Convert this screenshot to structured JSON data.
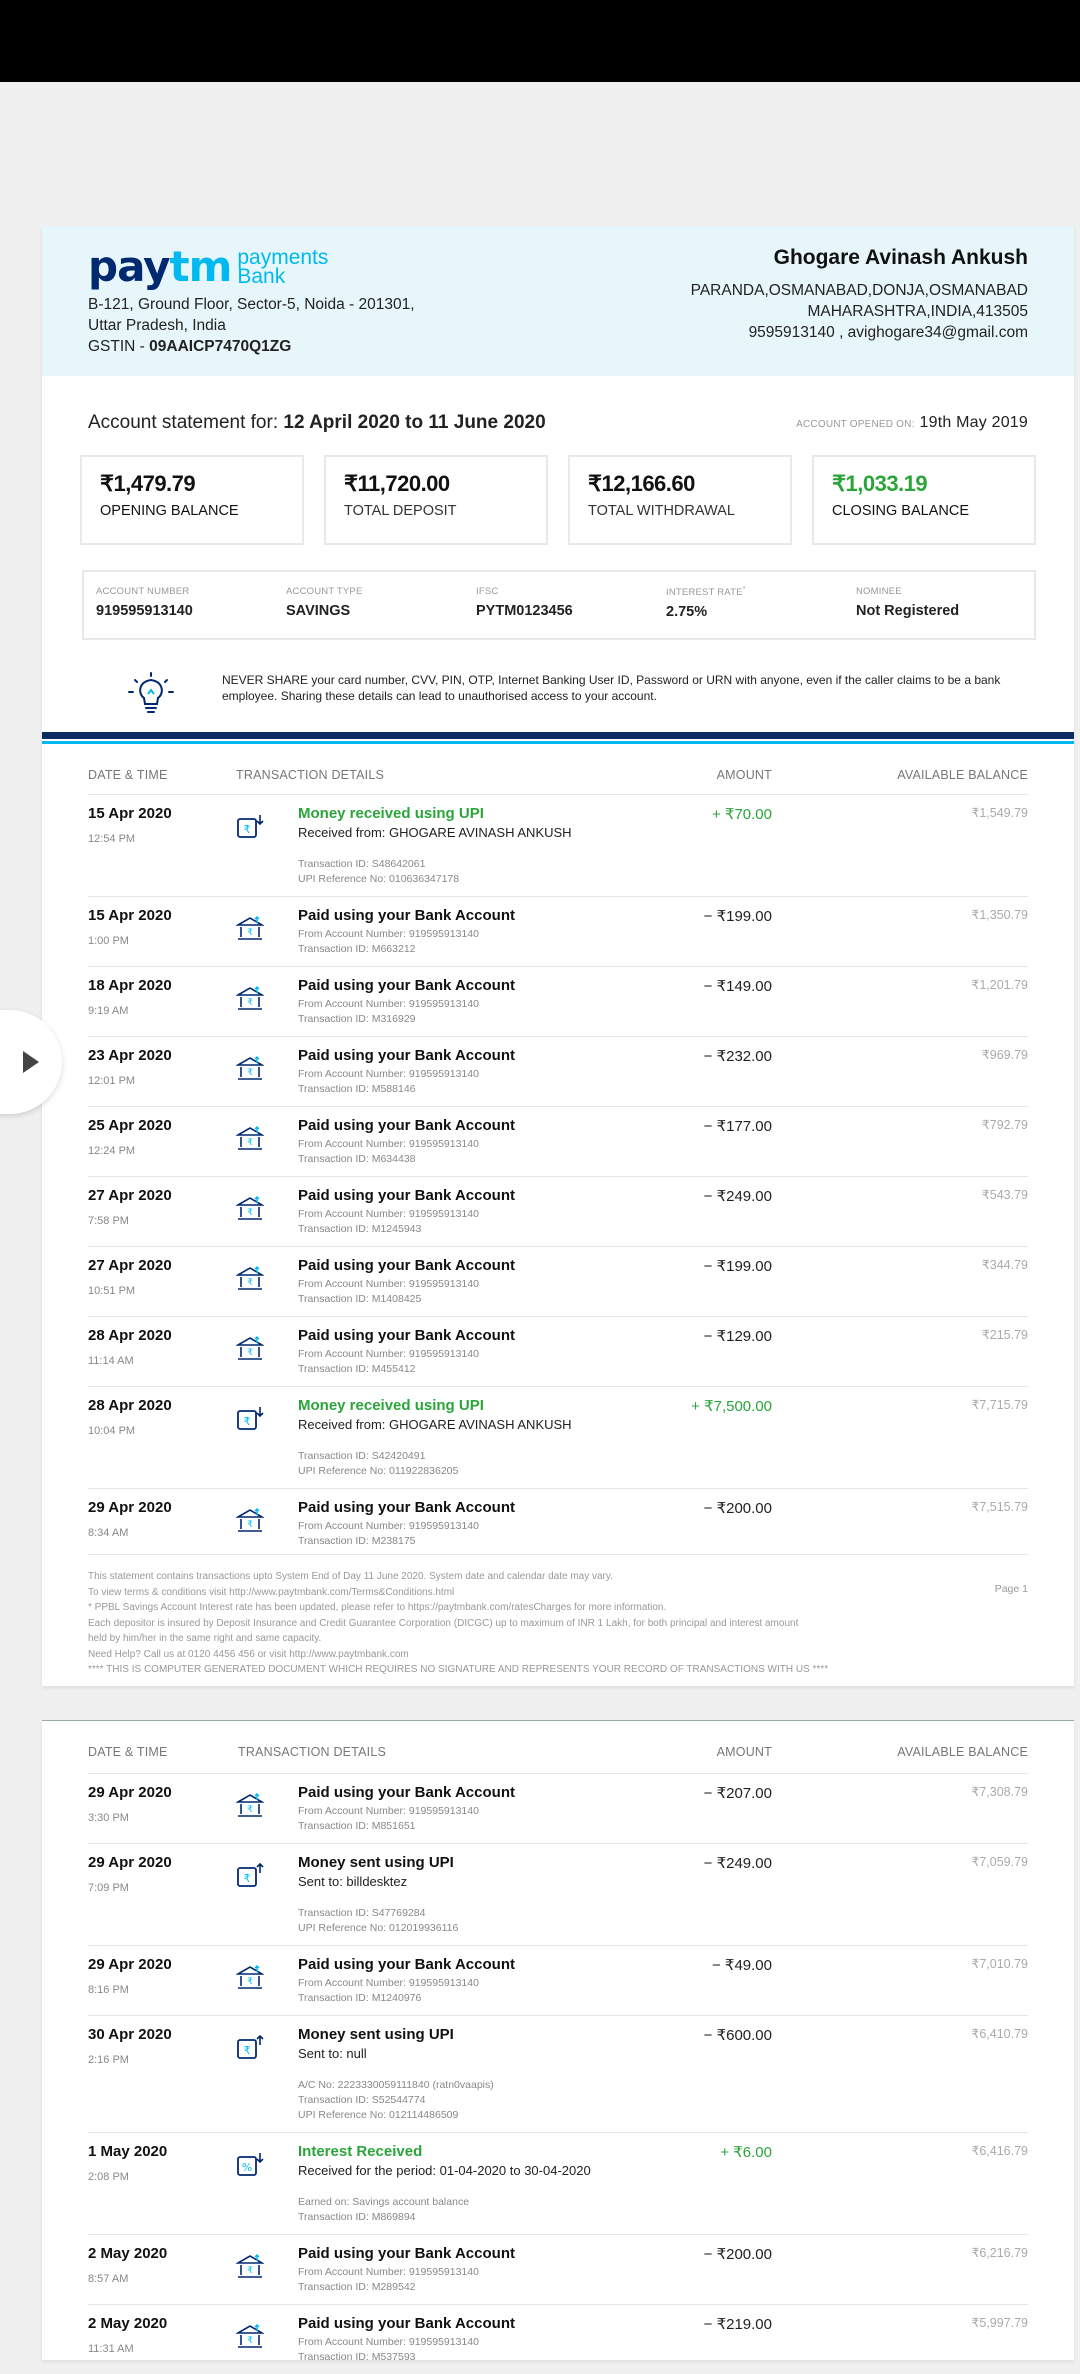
{
  "bank": {
    "logo_brand": "paytm",
    "logo_sub_1": "payments",
    "logo_sub_2": "Bank",
    "address_1": "B-121, Ground Floor, Sector-5, Noida - 201301,",
    "address_2": "Uttar Pradesh, India",
    "gstin_label": "GSTIN -",
    "gstin": "09AAICP7470Q1ZG"
  },
  "customer": {
    "name": "Ghogare Avinash Ankush",
    "address_1": "PARANDA,OSMANABAD,DONJA,OSMANABAD",
    "address_2": "MAHARASHTRA,INDIA,413505",
    "contact": "9595913140 , avighogare34@gmail.com"
  },
  "statement": {
    "label": "Account statement for:",
    "period": "12 April 2020 to 11 June 2020",
    "opened_label": "ACCOUNT OPENED ON:",
    "opened_date": "19th May 2019"
  },
  "summary": [
    {
      "value": "₹1,479.79",
      "label": "OPENING BALANCE"
    },
    {
      "value": "₹11,720.00",
      "label": "TOTAL DEPOSIT"
    },
    {
      "value": "₹12,166.60",
      "label": "TOTAL WITHDRAWAL"
    },
    {
      "value": "₹1,033.19",
      "label": "CLOSING BALANCE"
    }
  ],
  "account": [
    {
      "key": "ACCOUNT NUMBER",
      "value": "919595913140"
    },
    {
      "key": "ACCOUNT TYPE",
      "value": "SAVINGS"
    },
    {
      "key": "IFSC",
      "value": "PYTM0123456"
    },
    {
      "key": "INTEREST RATE",
      "value": "2.75%"
    },
    {
      "key": "NOMINEE",
      "value": "Not Registered"
    }
  ],
  "notice": "NEVER SHARE your card number, CVV, PIN, OTP, Internet Banking User ID, Password or URN with anyone, even if the caller claims to be a bank employee. Sharing these details can lead to unauthorised access to your account.",
  "table_headers": {
    "date": "DATE & TIME",
    "details": "TRANSACTION DETAILS",
    "amount": "AMOUNT",
    "balance": "AVAILABLE BALANCE"
  },
  "page1_rows": [
    {
      "date": "15 Apr 2020",
      "time": "12:54 PM",
      "title": "Money received using UPI",
      "sub": "Received from: GHOGARE AVINASH ANKUSH",
      "meta": [
        "Transaction ID: S48642061",
        "UPI Reference No: 010636347178"
      ],
      "amount": "+ ₹70.00",
      "balance": "₹1,549.79",
      "kind": "in"
    },
    {
      "date": "15 Apr 2020",
      "time": "1:00 PM",
      "title": "Paid using your Bank Account",
      "meta": [
        "From Account Number: 919595913140",
        "Transaction ID: M663212"
      ],
      "amount": "− ₹199.00",
      "balance": "₹1,350.79",
      "kind": "bank"
    },
    {
      "date": "18 Apr 2020",
      "time": "9:19 AM",
      "title": "Paid using your Bank Account",
      "meta": [
        "From Account Number: 919595913140",
        "Transaction ID: M316929"
      ],
      "amount": "− ₹149.00",
      "balance": "₹1,201.79",
      "kind": "bank"
    },
    {
      "date": "23 Apr 2020",
      "time": "12:01 PM",
      "title": "Paid using your Bank Account",
      "meta": [
        "From Account Number: 919595913140",
        "Transaction ID: M588146"
      ],
      "amount": "− ₹232.00",
      "balance": "₹969.79",
      "kind": "bank"
    },
    {
      "date": "25 Apr 2020",
      "time": "12:24 PM",
      "title": "Paid using your Bank Account",
      "meta": [
        "From Account Number: 919595913140",
        "Transaction ID: M634438"
      ],
      "amount": "− ₹177.00",
      "balance": "₹792.79",
      "kind": "bank"
    },
    {
      "date": "27 Apr 2020",
      "time": "7:58 PM",
      "title": "Paid using your Bank Account",
      "meta": [
        "From Account Number: 919595913140",
        "Transaction ID: M1245943"
      ],
      "amount": "− ₹249.00",
      "balance": "₹543.79",
      "kind": "bank"
    },
    {
      "date": "27 Apr 2020",
      "time": "10:51 PM",
      "title": "Paid using your Bank Account",
      "meta": [
        "From Account Number: 919595913140",
        "Transaction ID: M1408425"
      ],
      "amount": "− ₹199.00",
      "balance": "₹344.79",
      "kind": "bank"
    },
    {
      "date": "28 Apr 2020",
      "time": "11:14 AM",
      "title": "Paid using your Bank Account",
      "meta": [
        "From Account Number: 919595913140",
        "Transaction ID: M455412"
      ],
      "amount": "− ₹129.00",
      "balance": "₹215.79",
      "kind": "bank"
    },
    {
      "date": "28 Apr 2020",
      "time": "10:04 PM",
      "title": "Money received using UPI",
      "sub": "Received from: GHOGARE AVINASH ANKUSH",
      "meta": [
        "Transaction ID: S42420491",
        "UPI Reference No: 011922836205"
      ],
      "amount": "+ ₹7,500.00",
      "balance": "₹7,715.79",
      "kind": "in"
    },
    {
      "date": "29 Apr 2020",
      "time": "8:34 AM",
      "title": "Paid using your Bank Account",
      "meta": [
        "From Account Number: 919595913140",
        "Transaction ID: M238175"
      ],
      "amount": "− ₹200.00",
      "balance": "₹7,515.79",
      "kind": "bank"
    }
  ],
  "footer": [
    "This statement contains transactions upto System End of Day 11 June 2020. System date and calendar date may vary.",
    "To view terms & conditions visit http://www.paytmbank.com/Terms&Conditions.html",
    "* PPBL Savings Account Interest rate has been updated, please refer to https://paytmbank.com/ratesCharges for more information.",
    "Each depositor is insured by Deposit Insurance and Credit Guarantee Corporation (DICGC) up to maximum of INR 1 Lakh, for both principal and interest amount",
    "held by him/her in the same right and same capacity.",
    "Need Help? Call us at 0120 4456 456 or visit  http://www.paytmbank.com",
    "**** THIS IS COMPUTER GENERATED DOCUMENT WHICH REQUIRES NO SIGNATURE AND REPRESENTS YOUR RECORD OF TRANSACTIONS WITH US ****"
  ],
  "page_label": "Page 1",
  "page2_rows": [
    {
      "date": "29 Apr 2020",
      "time": "3:30 PM",
      "title": "Paid using your Bank Account",
      "meta": [
        "From Account Number: 919595913140",
        "Transaction ID: M851651"
      ],
      "amount": "− ₹207.00",
      "balance": "₹7,308.79",
      "kind": "bank"
    },
    {
      "date": "29 Apr 2020",
      "time": "7:09 PM",
      "title": "Money sent using UPI",
      "sub": "Sent to: billdesktez",
      "meta": [
        "Transaction ID: S47769284",
        "UPI Reference No: 012019936116"
      ],
      "amount": "− ₹249.00",
      "balance": "₹7,059.79",
      "kind": "out"
    },
    {
      "date": "29 Apr 2020",
      "time": "8:16 PM",
      "title": "Paid using your Bank Account",
      "meta": [
        "From Account Number: 919595913140",
        "Transaction ID: M1240976"
      ],
      "amount": "− ₹49.00",
      "balance": "₹7,010.79",
      "kind": "bank"
    },
    {
      "date": "30 Apr 2020",
      "time": "2:16 PM",
      "title": "Money sent using UPI",
      "sub": "Sent to: null",
      "meta": [
        "A/C No: 2223330059111840 (ratn0vaapis)",
        "Transaction ID: S52544774",
        "UPI Reference No: 012114486509"
      ],
      "amount": "− ₹600.00",
      "balance": "₹6,410.79",
      "kind": "out"
    },
    {
      "date": "1 May 2020",
      "time": "2:08 PM",
      "title": "Interest Received",
      "sub": "Received for the period: 01-04-2020 to 30-04-2020",
      "meta": [
        "Earned on: Savings account balance",
        "Transaction ID: M869894"
      ],
      "amount": "+ ₹6.00",
      "balance": "₹6,416.79",
      "kind": "interest"
    },
    {
      "date": "2 May 2020",
      "time": "8:57 AM",
      "title": "Paid using your Bank Account",
      "meta": [
        "From Account Number: 919595913140",
        "Transaction ID: M289542"
      ],
      "amount": "− ₹200.00",
      "balance": "₹6,216.79",
      "kind": "bank"
    },
    {
      "date": "2 May 2020",
      "time": "11:31 AM",
      "title": "Paid using your Bank Account",
      "meta": [
        "From Account Number: 919595913140",
        "Transaction ID: M537593"
      ],
      "amount": "− ₹219.00",
      "balance": "₹5,997.79",
      "kind": "bank"
    }
  ],
  "colors": {
    "brand_navy": "#002970",
    "brand_cyan": "#00b9f1",
    "credit_green": "#2ba53a",
    "header_bg": "#e6f6fb"
  },
  "icons": {
    "bank": "bank-building-icon",
    "in": "receive-arrow-icon",
    "out": "send-arrow-icon",
    "interest": "percent-icon",
    "bulb": "lightbulb-icon",
    "play": "play-icon"
  }
}
